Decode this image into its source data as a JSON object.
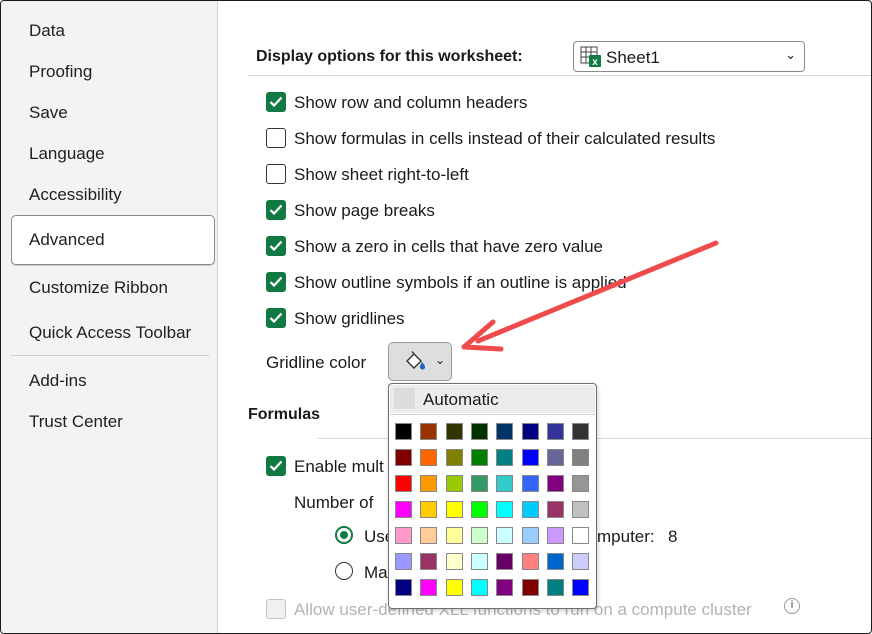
{
  "sidebar": {
    "items": [
      {
        "label": "Data"
      },
      {
        "label": "Proofing"
      },
      {
        "label": "Save"
      },
      {
        "label": "Language"
      },
      {
        "label": "Accessibility"
      },
      {
        "label": "Advanced",
        "selected": true
      },
      {
        "label": "Customize Ribbon"
      },
      {
        "label": "Quick Access Toolbar"
      },
      {
        "label": "Add-ins"
      },
      {
        "label": "Trust Center"
      }
    ]
  },
  "display": {
    "title": "Display options for this worksheet:",
    "sheet_value": "Sheet1",
    "options": [
      {
        "label": "Show row and column headers",
        "checked": true
      },
      {
        "label": "Show formulas in cells instead of their calculated results",
        "checked": false
      },
      {
        "label": "Show sheet right-to-left",
        "checked": false
      },
      {
        "label": "Show page breaks",
        "checked": true
      },
      {
        "label": "Show a zero in cells that have zero value",
        "checked": true
      },
      {
        "label": "Show outline symbols if an outline is applied",
        "checked": true
      },
      {
        "label": "Show gridlines",
        "checked": true
      }
    ],
    "gridline_color_label": "Gridline color"
  },
  "palette": {
    "automatic_label": "Automatic",
    "colors": [
      [
        "#000000",
        "#993300",
        "#333300",
        "#003300",
        "#003366",
        "#000080",
        "#333399",
        "#333333"
      ],
      [
        "#800000",
        "#FF6600",
        "#808000",
        "#008000",
        "#008080",
        "#0000FF",
        "#666699",
        "#808080"
      ],
      [
        "#FF0000",
        "#FF9900",
        "#99CC00",
        "#339966",
        "#33CCCC",
        "#3366FF",
        "#800080",
        "#969696"
      ],
      [
        "#FF00FF",
        "#FFCC00",
        "#FFFF00",
        "#00FF00",
        "#00FFFF",
        "#00CCFF",
        "#993366",
        "#C0C0C0"
      ],
      [
        "#FF99CC",
        "#FFCC99",
        "#FFFF99",
        "#CCFFCC",
        "#CCFFFF",
        "#99CCFF",
        "#CC99FF",
        "#FFFFFF"
      ],
      [
        "#9999FF",
        "#993366",
        "#FFFFCC",
        "#CCFFFF",
        "#660066",
        "#FF8080",
        "#0066CC",
        "#CCCCFF"
      ],
      [
        "#000080",
        "#FF00FF",
        "#FFFF00",
        "#00FFFF",
        "#800080",
        "#800000",
        "#008080",
        "#0000FF"
      ]
    ]
  },
  "formulas": {
    "title": "Formulas",
    "enable_label": "Enable mult",
    "number_label": "Number of",
    "use_label": "Use",
    "computer_label": "mputer:",
    "computer_value": "8",
    "manual_label": "Ma",
    "allow_label": "Allow user-defined XLL functions to run on a compute cluster"
  },
  "accent_color": "#117A43",
  "arrow_color": "#F04B4B"
}
